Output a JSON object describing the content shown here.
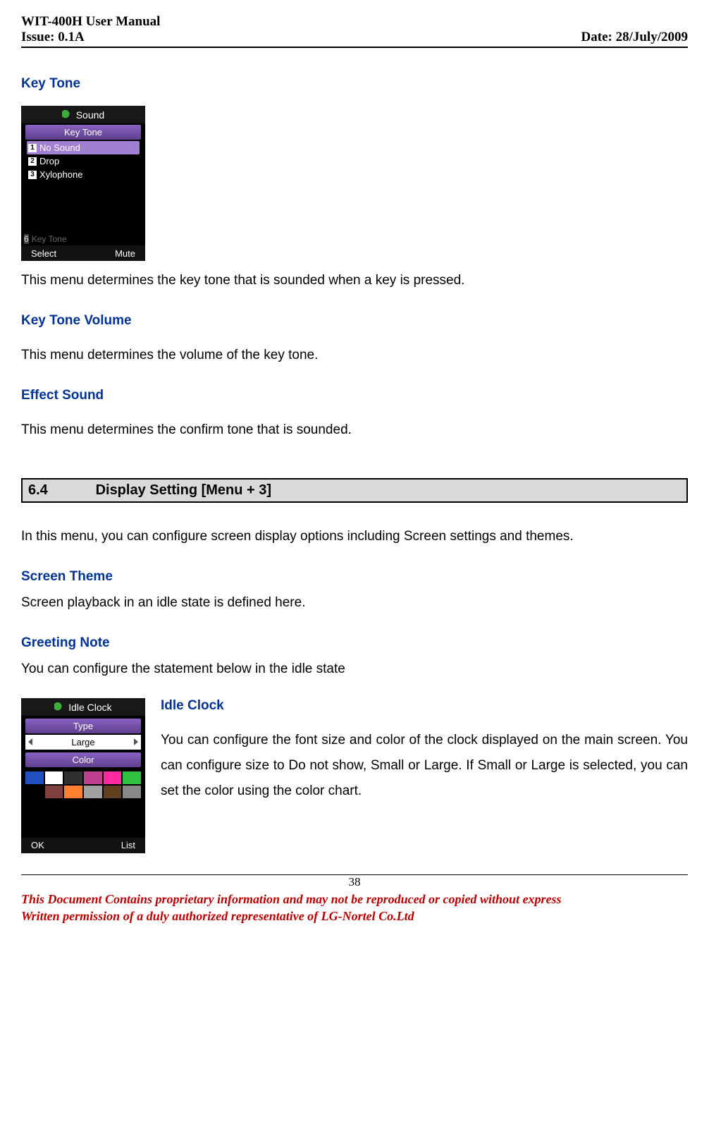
{
  "header": {
    "title": "WIT-400H User Manual",
    "issue": "Issue: 0.1A",
    "date": "Date: 28/July/2009"
  },
  "s_keytone": {
    "heading": "Key Tone",
    "screen": {
      "title": "Sound",
      "subtitle": "Key Tone",
      "items": [
        "No Sound",
        "Drop",
        "Xylophone"
      ],
      "faded": "Key Tone",
      "soft_left": "Select",
      "soft_right": "Mute"
    },
    "text": "This menu determines the key tone that is sounded when a key is pressed."
  },
  "s_keytonevol": {
    "heading": "Key Tone Volume",
    "text": "This menu determines the volume of the key tone."
  },
  "s_effect": {
    "heading": "Effect Sound",
    "text": "This menu determines the confirm tone that is sounded."
  },
  "bar": {
    "num": "6.4",
    "title": "Display Setting [Menu + 3]"
  },
  "display_intro": "In this menu, you can configure screen display options including Screen settings and themes.",
  "s_theme": {
    "heading": "Screen Theme",
    "text": "Screen playback in an idle state is defined here."
  },
  "s_greet": {
    "heading": "Greeting Note",
    "text": "You can configure the statement below in the idle state"
  },
  "s_idle": {
    "heading": "Idle Clock",
    "text": "You can configure the font size and color of the clock displayed on the main screen. You can configure size to Do not show, Small or Large. If Small or Large is selected, you can set the color using the color chart.",
    "screen": {
      "title": "Idle Clock",
      "label_type": "Type",
      "value_type": "Large",
      "label_color": "Color",
      "colors": [
        "#2050c0",
        "#ffffff",
        "#303030",
        "#c04090",
        "#ff2aa0",
        "#30c040",
        "#000000",
        "#804040",
        "#ff8030",
        "#a0a0a0",
        "#604020",
        "#888888"
      ],
      "soft_left": "OK",
      "soft_right": "List"
    }
  },
  "footer": {
    "page": "38",
    "line1": "This Document Contains proprietary information and may not be reproduced or copied without express",
    "line2": "Written permission of a duly authorized representative of LG-Nortel Co.Ltd"
  }
}
